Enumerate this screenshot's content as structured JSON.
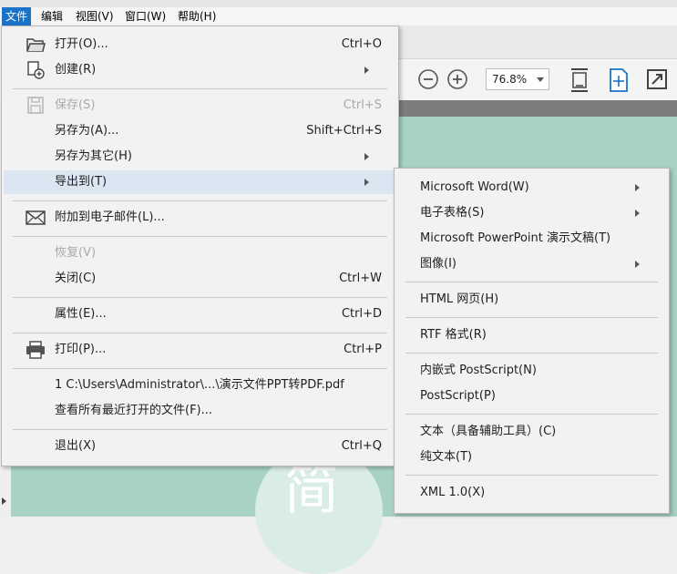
{
  "menubar": {
    "items": [
      {
        "label": "文件"
      },
      {
        "label": "编辑"
      },
      {
        "label": "视图(V)"
      },
      {
        "label": "窗口(W)"
      },
      {
        "label": "帮助(H)"
      }
    ]
  },
  "toolbar": {
    "zoom_value": "76.8%",
    "zoom_out_icon": "minus-circle-icon",
    "zoom_in_icon": "plus-circle-icon"
  },
  "document": {
    "visible_char": "简"
  },
  "file_menu": {
    "items": [
      {
        "label": "打开(O)...",
        "shortcut": "Ctrl+O",
        "icon": "folder-open-icon"
      },
      {
        "label": "创建(R)",
        "shortcut": "",
        "icon": "create-document-icon",
        "submenu": true
      },
      {
        "label": "保存(S)",
        "shortcut": "Ctrl+S",
        "icon": "save-icon",
        "disabled": true
      },
      {
        "label": "另存为(A)...",
        "shortcut": "Shift+Ctrl+S"
      },
      {
        "label": "另存为其它(H)",
        "shortcut": "",
        "submenu": true
      },
      {
        "label": "导出到(T)",
        "shortcut": "",
        "submenu": true,
        "highlight": true
      },
      {
        "label": "附加到电子邮件(L)...",
        "shortcut": "",
        "icon": "envelope-icon"
      },
      {
        "label": "恢复(V)",
        "shortcut": "",
        "disabled": true
      },
      {
        "label": "关闭(C)",
        "shortcut": "Ctrl+W"
      },
      {
        "label": "属性(E)...",
        "shortcut": "Ctrl+D"
      },
      {
        "label": "打印(P)...",
        "shortcut": "Ctrl+P",
        "icon": "printer-icon"
      },
      {
        "label": "1 C:\\Users\\Administrator\\...\\演示文件PPT转PDF.pdf",
        "shortcut": ""
      },
      {
        "label": "查看所有最近打开的文件(F)...",
        "shortcut": ""
      },
      {
        "label": "退出(X)",
        "shortcut": "Ctrl+Q"
      }
    ]
  },
  "export_menu": {
    "items": [
      {
        "label": "Microsoft Word(W)",
        "submenu": true
      },
      {
        "label": "电子表格(S)",
        "submenu": true
      },
      {
        "label": "Microsoft PowerPoint 演示文稿(T)"
      },
      {
        "label": "图像(I)",
        "submenu": true
      },
      {
        "label": "HTML 网页(H)"
      },
      {
        "label": "RTF 格式(R)"
      },
      {
        "label": "内嵌式 PostScript(N)"
      },
      {
        "label": "PostScript(P)"
      },
      {
        "label": "文本（具备辅助工具）(C)"
      },
      {
        "label": "纯文本(T)"
      },
      {
        "label": "XML 1.0(X)"
      }
    ]
  },
  "colors": {
    "menubar_active": "#1a73c8",
    "menu_bg": "#f2f2f2",
    "highlight": "#dce6f3",
    "page_bg": "#a7d2c5",
    "doc_bg": "#7d7d7d"
  }
}
